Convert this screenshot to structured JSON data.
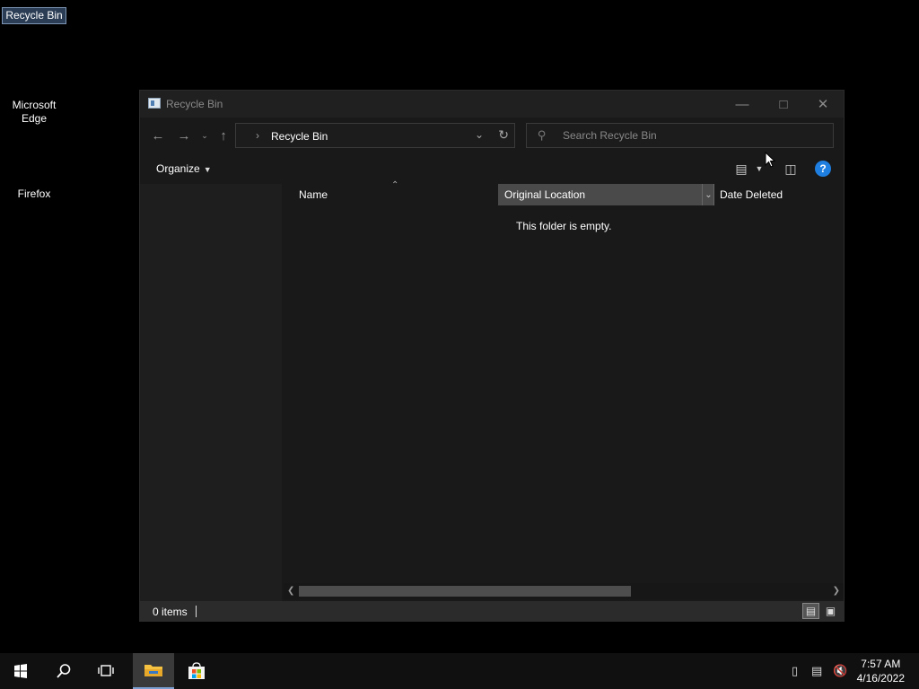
{
  "desktop": {
    "icons": [
      {
        "label": "Recycle Bin"
      },
      {
        "label": "Microsoft Edge"
      },
      {
        "label": "Firefox"
      }
    ]
  },
  "window": {
    "title": "Recycle Bin",
    "address": {
      "path": "Recycle Bin"
    },
    "search": {
      "placeholder": "Search Recycle Bin"
    },
    "command_bar": {
      "organize_label": "Organize"
    },
    "columns": {
      "name": "Name",
      "original_location": "Original Location",
      "date_deleted": "Date Deleted"
    },
    "empty_message": "This folder is empty.",
    "status": {
      "item_count": "0 items"
    }
  },
  "taskbar": {
    "clock": {
      "time": "7:57 AM",
      "date": "4/16/2022"
    }
  },
  "colors": {
    "accent": "#1f7fe0",
    "window_bg": "#191919",
    "titlebar_bg": "#202020",
    "taskbar_bg": "#101010"
  }
}
